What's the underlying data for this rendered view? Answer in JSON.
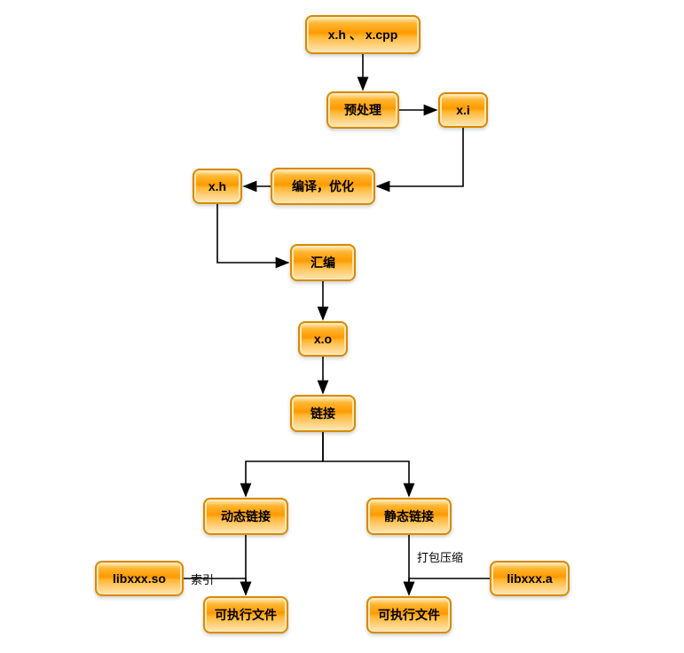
{
  "nodes": {
    "source": {
      "label": "x.h 、 x.cpp"
    },
    "preprocess": {
      "label": "预处理"
    },
    "xi": {
      "label": "x.i"
    },
    "compile": {
      "label": "编译，优化"
    },
    "xh": {
      "label": "x.h"
    },
    "assemble": {
      "label": "汇编"
    },
    "xo": {
      "label": "x.o"
    },
    "link": {
      "label": "链接"
    },
    "dynlink": {
      "label": "动态链接"
    },
    "staticlink": {
      "label": "静态链接"
    },
    "libso": {
      "label": "libxxx.so"
    },
    "liba": {
      "label": "libxxx.a"
    },
    "exe1": {
      "label": "可执行文件"
    },
    "exe2": {
      "label": "可执行文件"
    }
  },
  "edgeLabels": {
    "index": "索引",
    "archive": "打包压缩"
  },
  "chart_data": {
    "type": "flowchart",
    "nodes": [
      {
        "id": "source",
        "label": "x.h 、 x.cpp"
      },
      {
        "id": "preprocess",
        "label": "预处理"
      },
      {
        "id": "xi",
        "label": "x.i"
      },
      {
        "id": "compile",
        "label": "编译，优化"
      },
      {
        "id": "xh",
        "label": "x.h"
      },
      {
        "id": "assemble",
        "label": "汇编"
      },
      {
        "id": "xo",
        "label": "x.o"
      },
      {
        "id": "link",
        "label": "链接"
      },
      {
        "id": "dynlink",
        "label": "动态链接"
      },
      {
        "id": "staticlink",
        "label": "静态链接"
      },
      {
        "id": "libso",
        "label": "libxxx.so"
      },
      {
        "id": "liba",
        "label": "libxxx.a"
      },
      {
        "id": "exe1",
        "label": "可执行文件"
      },
      {
        "id": "exe2",
        "label": "可执行文件"
      }
    ],
    "edges": [
      {
        "from": "source",
        "to": "preprocess"
      },
      {
        "from": "preprocess",
        "to": "xi"
      },
      {
        "from": "xi",
        "to": "compile"
      },
      {
        "from": "compile",
        "to": "xh"
      },
      {
        "from": "xh",
        "to": "assemble"
      },
      {
        "from": "assemble",
        "to": "xo"
      },
      {
        "from": "xo",
        "to": "link"
      },
      {
        "from": "link",
        "to": "dynlink"
      },
      {
        "from": "link",
        "to": "staticlink"
      },
      {
        "from": "dynlink",
        "to": "exe1"
      },
      {
        "from": "staticlink",
        "to": "exe2"
      },
      {
        "from": "libso",
        "to": "exe1",
        "label": "索引"
      },
      {
        "from": "liba",
        "to": "exe2",
        "label": "打包压缩"
      }
    ]
  }
}
